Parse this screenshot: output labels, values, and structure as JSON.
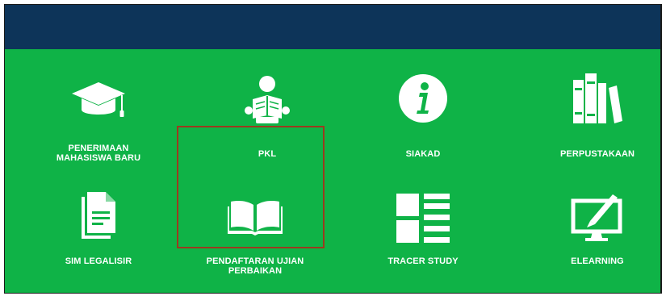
{
  "colors": {
    "header": "#0d3459",
    "background": "#0fb347",
    "icon": "#ffffff",
    "highlight_border": "#9b3b1f"
  },
  "menu": {
    "items": [
      {
        "label_line1": "PENERIMAAN",
        "label_line2": "MAHASISWA BARU",
        "icon": "graduation-cap-icon"
      },
      {
        "label_line1": "PKL",
        "label_line2": "",
        "icon": "reading-person-icon"
      },
      {
        "label_line1": "SIAKAD",
        "label_line2": "",
        "icon": "info-icon"
      },
      {
        "label_line1": "PERPUSTAKAAN",
        "label_line2": "",
        "icon": "books-icon"
      },
      {
        "label_line1": "SIM LEGALISIR",
        "label_line2": "",
        "icon": "document-icon"
      },
      {
        "label_line1": "PENDAFTARAN UJIAN",
        "label_line2": "PERBAIKAN",
        "icon": "open-book-icon"
      },
      {
        "label_line1": "TRACER STUDY",
        "label_line2": "",
        "icon": "list-layout-icon"
      },
      {
        "label_line1": "ELEARNING",
        "label_line2": "",
        "icon": "monitor-pen-icon"
      }
    ]
  }
}
